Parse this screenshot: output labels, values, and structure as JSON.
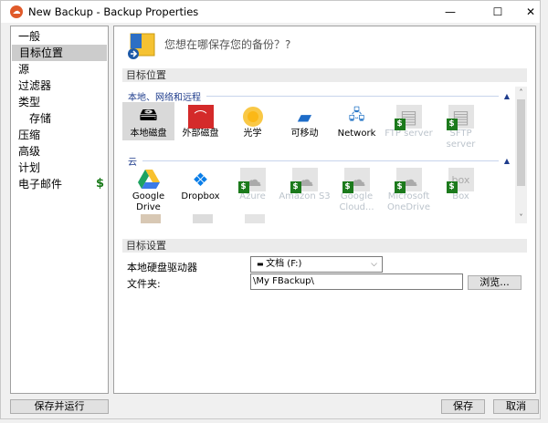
{
  "window": {
    "title": "New Backup - Backup Properties",
    "minimize": "—",
    "maximize": "☐",
    "close": "✕"
  },
  "sidebar": {
    "items": [
      {
        "label": "一般"
      },
      {
        "label": "目标位置"
      },
      {
        "label": "源"
      },
      {
        "label": "过滤器"
      },
      {
        "label": "类型"
      },
      {
        "label": "存储"
      },
      {
        "label": "压缩"
      },
      {
        "label": "高级"
      },
      {
        "label": "计划"
      },
      {
        "label": "电子邮件",
        "badge": "$"
      }
    ]
  },
  "main": {
    "question": "您想在哪保存您的备份？?",
    "section_destination": "目标位置",
    "group_local": "本地、网络和远程",
    "group_cloud": "云",
    "local_items": [
      {
        "label": "本地磁盘"
      },
      {
        "label": "外部磁盘"
      },
      {
        "label": "光学"
      },
      {
        "label": "可移动"
      },
      {
        "label": "Network"
      },
      {
        "label": "FTP server"
      },
      {
        "label": "SFTP server"
      }
    ],
    "cloud_items": [
      {
        "label": "Google Drive"
      },
      {
        "label": "Dropbox"
      },
      {
        "label": "Azure"
      },
      {
        "label": "Amazon S3"
      },
      {
        "label": "Google Cloud..."
      },
      {
        "label": "Microsoft OneDrive"
      },
      {
        "label": "Box"
      }
    ],
    "section_settings": "目标设置",
    "drive_label": "本地硬盘驱动器",
    "drive_value": "文档 (F:)",
    "folder_label": "文件夹:",
    "folder_value": "\\My FBackup\\",
    "browse": "浏览..."
  },
  "footer": {
    "save_run": "保存并运行",
    "save": "保存",
    "cancel": "取消"
  }
}
